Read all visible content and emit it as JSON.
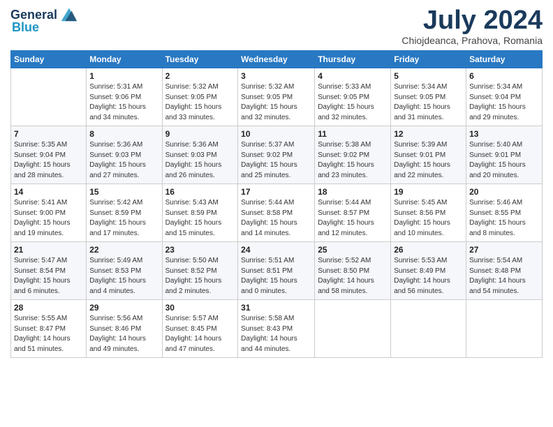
{
  "header": {
    "logo_line1": "General",
    "logo_line2": "Blue",
    "month": "July 2024",
    "location": "Chiojdeanca, Prahova, Romania"
  },
  "days_of_week": [
    "Sunday",
    "Monday",
    "Tuesday",
    "Wednesday",
    "Thursday",
    "Friday",
    "Saturday"
  ],
  "weeks": [
    [
      {
        "num": "",
        "info": ""
      },
      {
        "num": "1",
        "info": "Sunrise: 5:31 AM\nSunset: 9:06 PM\nDaylight: 15 hours\nand 34 minutes."
      },
      {
        "num": "2",
        "info": "Sunrise: 5:32 AM\nSunset: 9:05 PM\nDaylight: 15 hours\nand 33 minutes."
      },
      {
        "num": "3",
        "info": "Sunrise: 5:32 AM\nSunset: 9:05 PM\nDaylight: 15 hours\nand 32 minutes."
      },
      {
        "num": "4",
        "info": "Sunrise: 5:33 AM\nSunset: 9:05 PM\nDaylight: 15 hours\nand 32 minutes."
      },
      {
        "num": "5",
        "info": "Sunrise: 5:34 AM\nSunset: 9:05 PM\nDaylight: 15 hours\nand 31 minutes."
      },
      {
        "num": "6",
        "info": "Sunrise: 5:34 AM\nSunset: 9:04 PM\nDaylight: 15 hours\nand 29 minutes."
      }
    ],
    [
      {
        "num": "7",
        "info": "Sunrise: 5:35 AM\nSunset: 9:04 PM\nDaylight: 15 hours\nand 28 minutes."
      },
      {
        "num": "8",
        "info": "Sunrise: 5:36 AM\nSunset: 9:03 PM\nDaylight: 15 hours\nand 27 minutes."
      },
      {
        "num": "9",
        "info": "Sunrise: 5:36 AM\nSunset: 9:03 PM\nDaylight: 15 hours\nand 26 minutes."
      },
      {
        "num": "10",
        "info": "Sunrise: 5:37 AM\nSunset: 9:02 PM\nDaylight: 15 hours\nand 25 minutes."
      },
      {
        "num": "11",
        "info": "Sunrise: 5:38 AM\nSunset: 9:02 PM\nDaylight: 15 hours\nand 23 minutes."
      },
      {
        "num": "12",
        "info": "Sunrise: 5:39 AM\nSunset: 9:01 PM\nDaylight: 15 hours\nand 22 minutes."
      },
      {
        "num": "13",
        "info": "Sunrise: 5:40 AM\nSunset: 9:01 PM\nDaylight: 15 hours\nand 20 minutes."
      }
    ],
    [
      {
        "num": "14",
        "info": "Sunrise: 5:41 AM\nSunset: 9:00 PM\nDaylight: 15 hours\nand 19 minutes."
      },
      {
        "num": "15",
        "info": "Sunrise: 5:42 AM\nSunset: 8:59 PM\nDaylight: 15 hours\nand 17 minutes."
      },
      {
        "num": "16",
        "info": "Sunrise: 5:43 AM\nSunset: 8:59 PM\nDaylight: 15 hours\nand 15 minutes."
      },
      {
        "num": "17",
        "info": "Sunrise: 5:44 AM\nSunset: 8:58 PM\nDaylight: 15 hours\nand 14 minutes."
      },
      {
        "num": "18",
        "info": "Sunrise: 5:44 AM\nSunset: 8:57 PM\nDaylight: 15 hours\nand 12 minutes."
      },
      {
        "num": "19",
        "info": "Sunrise: 5:45 AM\nSunset: 8:56 PM\nDaylight: 15 hours\nand 10 minutes."
      },
      {
        "num": "20",
        "info": "Sunrise: 5:46 AM\nSunset: 8:55 PM\nDaylight: 15 hours\nand 8 minutes."
      }
    ],
    [
      {
        "num": "21",
        "info": "Sunrise: 5:47 AM\nSunset: 8:54 PM\nDaylight: 15 hours\nand 6 minutes."
      },
      {
        "num": "22",
        "info": "Sunrise: 5:49 AM\nSunset: 8:53 PM\nDaylight: 15 hours\nand 4 minutes."
      },
      {
        "num": "23",
        "info": "Sunrise: 5:50 AM\nSunset: 8:52 PM\nDaylight: 15 hours\nand 2 minutes."
      },
      {
        "num": "24",
        "info": "Sunrise: 5:51 AM\nSunset: 8:51 PM\nDaylight: 15 hours\nand 0 minutes."
      },
      {
        "num": "25",
        "info": "Sunrise: 5:52 AM\nSunset: 8:50 PM\nDaylight: 14 hours\nand 58 minutes."
      },
      {
        "num": "26",
        "info": "Sunrise: 5:53 AM\nSunset: 8:49 PM\nDaylight: 14 hours\nand 56 minutes."
      },
      {
        "num": "27",
        "info": "Sunrise: 5:54 AM\nSunset: 8:48 PM\nDaylight: 14 hours\nand 54 minutes."
      }
    ],
    [
      {
        "num": "28",
        "info": "Sunrise: 5:55 AM\nSunset: 8:47 PM\nDaylight: 14 hours\nand 51 minutes."
      },
      {
        "num": "29",
        "info": "Sunrise: 5:56 AM\nSunset: 8:46 PM\nDaylight: 14 hours\nand 49 minutes."
      },
      {
        "num": "30",
        "info": "Sunrise: 5:57 AM\nSunset: 8:45 PM\nDaylight: 14 hours\nand 47 minutes."
      },
      {
        "num": "31",
        "info": "Sunrise: 5:58 AM\nSunset: 8:43 PM\nDaylight: 14 hours\nand 44 minutes."
      },
      {
        "num": "",
        "info": ""
      },
      {
        "num": "",
        "info": ""
      },
      {
        "num": "",
        "info": ""
      }
    ]
  ]
}
